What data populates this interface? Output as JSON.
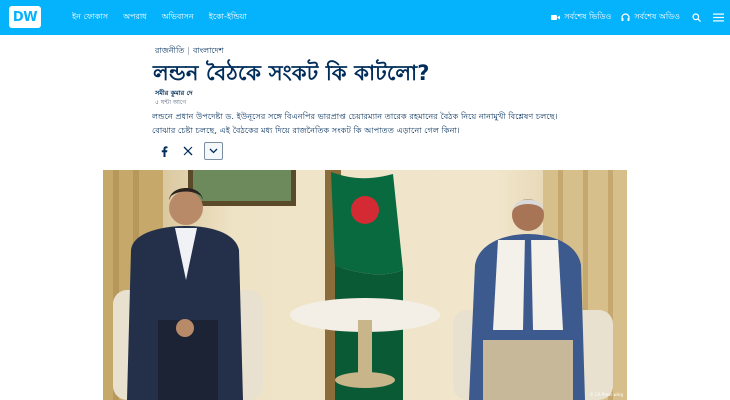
{
  "header": {
    "logo": "DW",
    "nav": [
      "ইন ফোকাস",
      "অপরাধ",
      "অভিবাসন",
      "ইকো-ইন্ডিয়া"
    ],
    "latest_video": "সর্বশেষ ভিডিও",
    "latest_audio": "সর্বশেষ অডিও"
  },
  "article": {
    "kicker_topic": "রাজনীতি",
    "kicker_region": "বাংলাদেশ",
    "title": "লন্ডন বৈঠকে সংকট কি কাটলো?",
    "author": "সমীর কুমার দে",
    "time": "৫ ঘন্টা আগে",
    "teaser": "লন্ডনে প্রধান উপদেষ্টা ড. ইউনূসের সঙ্গে বিএনপির ভারপ্রাপ্ত চেয়ারম্যান তারেক রহমানের বৈঠক নিয়ে নানামুখী বিশ্লেষণ চলছে। বোঝার চেষ্টা চলছে, এই বৈঠকের মধ্য দিয়ে রাজনৈতিক সংকট কি আপাতত এড়ানো গেল কিনা।"
  },
  "photo": {
    "credit": "© CA Press wing"
  },
  "colors": {
    "brand_blue": "#05b2fc",
    "text_navy": "#002d5a"
  }
}
